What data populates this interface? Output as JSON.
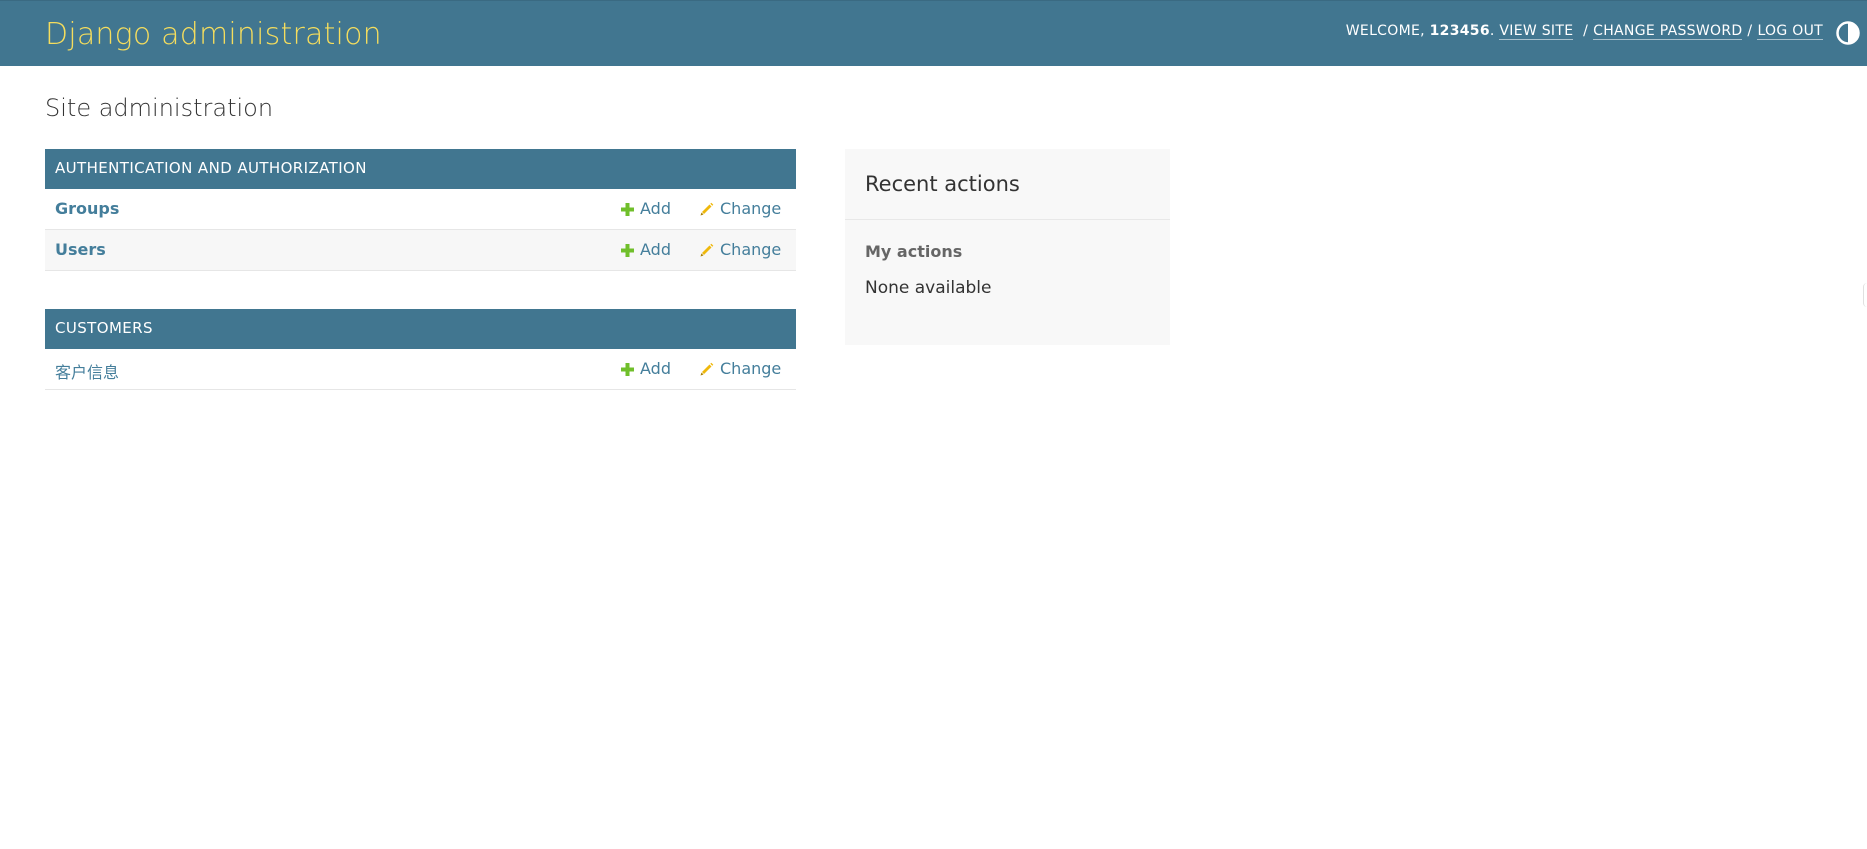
{
  "header": {
    "branding": "Django administration",
    "welcome": "Welcome,",
    "username": "123456",
    "username_suffix": ".",
    "view_site": "View site",
    "change_password": "Change password",
    "log_out": "Log out",
    "separator": "/",
    "theme_toggle_icon": "half-circle-theme-icon"
  },
  "page_title": "Site administration",
  "modules": [
    {
      "caption": "Authentication and Authorization",
      "models": [
        {
          "name": "Groups",
          "add": "Add",
          "change": "Change"
        },
        {
          "name": "Users",
          "add": "Add",
          "change": "Change"
        }
      ]
    },
    {
      "caption": "Customers",
      "models": [
        {
          "name": "客户信息",
          "add": "Add",
          "change": "Change"
        }
      ]
    }
  ],
  "recent_actions": {
    "title": "Recent actions",
    "subtitle": "My actions",
    "empty": "None available"
  },
  "colors": {
    "header_bg": "#417690",
    "branding": "#f5dd5d",
    "link": "#447e9b",
    "add_icon": "#70bf2b",
    "change_icon": "#efb80b"
  }
}
